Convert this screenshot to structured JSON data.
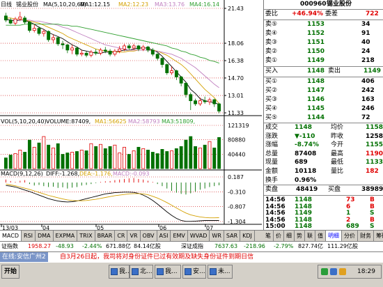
{
  "chart_header": {
    "period": "日线",
    "stock": "锡业股份",
    "ma_label": "MA(5,10,20,60)",
    "ma1": "MA1:12.15",
    "ma2": "MA2:12.23",
    "ma3": "MA3:13.76",
    "ma4": "MA4:16.14"
  },
  "price_axis": [
    "21.43",
    "18.06",
    "16.38",
    "14.70",
    "13.01",
    "11.33"
  ],
  "volume_header": {
    "label": "VOL(5,10,20,40)",
    "volume": "VOLUME:87409,",
    "ma1": "MA1:56625",
    "ma2": "MA2:58793",
    "ma3": "MA3:51809,"
  },
  "volume_axis": [
    "121319",
    "80880",
    "40440"
  ],
  "macd_header": {
    "label": "MACD(9,12,26)",
    "diff": "DIFF:-1.268,",
    "dea": "DEA:-1.176,",
    "macd": "MACD:-0.093"
  },
  "macd_axis": [
    "0.187",
    "-0.310",
    "-0.807",
    "-1.304"
  ],
  "date_labels": [
    "13/03",
    "04",
    "05",
    "06",
    "07"
  ],
  "chart_data": [
    {
      "type": "candlestick",
      "title": "日线 锡业股份",
      "ylim": [
        11.33,
        21.43
      ],
      "candles": [
        {
          "o": 20.7,
          "c": 20.3,
          "h": 21.0,
          "l": 20.1
        },
        {
          "o": 20.3,
          "c": 20.0,
          "h": 20.5,
          "l": 19.9
        },
        {
          "o": 20.0,
          "c": 20.4,
          "h": 20.6,
          "l": 19.8
        },
        {
          "o": 20.4,
          "c": 20.6,
          "h": 21.1,
          "l": 20.2
        },
        {
          "o": 20.5,
          "c": 20.1,
          "h": 20.7,
          "l": 19.9
        },
        {
          "o": 20.1,
          "c": 19.3,
          "h": 20.2,
          "l": 19.1
        },
        {
          "o": 19.3,
          "c": 19.5,
          "h": 19.9,
          "l": 19.1
        },
        {
          "o": 19.5,
          "c": 19.0,
          "h": 19.7,
          "l": 18.8
        },
        {
          "o": 19.0,
          "c": 19.2,
          "h": 19.4,
          "l": 18.7
        },
        {
          "o": 19.2,
          "c": 18.4,
          "h": 19.3,
          "l": 18.2
        },
        {
          "o": 18.4,
          "c": 18.6,
          "h": 18.9,
          "l": 18.1
        },
        {
          "o": 18.6,
          "c": 18.0,
          "h": 18.7,
          "l": 17.8
        },
        {
          "o": 18.0,
          "c": 17.9,
          "h": 18.3,
          "l": 17.5
        },
        {
          "o": 17.9,
          "c": 17.4,
          "h": 18.0,
          "l": 17.1
        },
        {
          "o": 17.4,
          "c": 17.6,
          "h": 17.9,
          "l": 17.0
        },
        {
          "o": 17.6,
          "c": 17.0,
          "h": 17.7,
          "l": 16.8
        },
        {
          "o": 17.0,
          "c": 17.1,
          "h": 17.4,
          "l": 16.8
        },
        {
          "o": 17.1,
          "c": 16.9,
          "h": 17.3,
          "l": 16.7
        },
        {
          "o": 16.9,
          "c": 17.2,
          "h": 17.4,
          "l": 16.7
        },
        {
          "o": 17.2,
          "c": 17.1,
          "h": 17.5,
          "l": 16.9
        },
        {
          "o": 17.1,
          "c": 17.4,
          "h": 17.6,
          "l": 16.9
        },
        {
          "o": 17.4,
          "c": 17.3,
          "h": 17.7,
          "l": 17.1
        },
        {
          "o": 17.3,
          "c": 17.0,
          "h": 17.5,
          "l": 16.8
        },
        {
          "o": 17.0,
          "c": 17.3,
          "h": 17.5,
          "l": 16.8
        },
        {
          "o": 17.3,
          "c": 17.5,
          "h": 17.8,
          "l": 17.1
        },
        {
          "o": 17.5,
          "c": 17.8,
          "h": 18.0,
          "l": 17.3
        },
        {
          "o": 17.8,
          "c": 17.6,
          "h": 18.0,
          "l": 17.4
        },
        {
          "o": 17.6,
          "c": 17.8,
          "h": 18.0,
          "l": 17.4
        },
        {
          "o": 17.8,
          "c": 17.5,
          "h": 17.9,
          "l": 17.3
        },
        {
          "o": 17.5,
          "c": 17.7,
          "h": 17.9,
          "l": 17.3
        },
        {
          "o": 17.7,
          "c": 17.4,
          "h": 17.8,
          "l": 17.2
        },
        {
          "o": 17.4,
          "c": 17.0,
          "h": 17.6,
          "l": 16.8
        },
        {
          "o": 17.0,
          "c": 16.6,
          "h": 17.1,
          "l": 16.4
        },
        {
          "o": 16.6,
          "c": 16.0,
          "h": 16.7,
          "l": 15.7
        },
        {
          "o": 16.0,
          "c": 15.2,
          "h": 16.1,
          "l": 15.0
        },
        {
          "o": 15.2,
          "c": 15.4,
          "h": 15.8,
          "l": 15.0
        },
        {
          "o": 15.4,
          "c": 14.8,
          "h": 15.5,
          "l": 14.5
        },
        {
          "o": 14.8,
          "c": 14.2,
          "h": 14.9,
          "l": 13.9
        },
        {
          "o": 14.2,
          "c": 13.1,
          "h": 14.3,
          "l": 12.8
        },
        {
          "o": 13.1,
          "c": 12.5,
          "h": 13.3,
          "l": 11.6
        },
        {
          "o": 12.5,
          "c": 12.2,
          "h": 12.7,
          "l": 12.0
        },
        {
          "o": 12.2,
          "c": 12.5,
          "h": 12.8,
          "l": 12.0
        },
        {
          "o": 12.5,
          "c": 12.4,
          "h": 12.9,
          "l": 12.2
        },
        {
          "o": 12.4,
          "c": 12.6,
          "h": 12.8,
          "l": 12.1
        },
        {
          "o": 12.6,
          "c": 12.2,
          "h": 12.7,
          "l": 11.9
        },
        {
          "o": 12.2,
          "c": 11.5,
          "h": 12.3,
          "l": 11.3
        }
      ],
      "series": [
        {
          "name": "MA1",
          "values": [
            20.4,
            20.3,
            20.2,
            20.3,
            20.3,
            20.1,
            19.9,
            19.6,
            19.4,
            19.1,
            18.9,
            18.7,
            18.5,
            18.2,
            17.9,
            17.7,
            17.4,
            17.3,
            17.2,
            17.1,
            17.1,
            17.2,
            17.2,
            17.2,
            17.3,
            17.4,
            17.4,
            17.5,
            17.6,
            17.6,
            17.6,
            17.4,
            17.2,
            16.8,
            16.3,
            15.8,
            15.3,
            14.8,
            14.3,
            13.6,
            13.2,
            12.7,
            12.5,
            12.4,
            12.3,
            12.15
          ]
        },
        {
          "name": "MA2",
          "values": [
            20.5,
            20.5,
            20.4,
            20.4,
            20.3,
            20.2,
            20.1,
            20.0,
            19.8,
            19.6,
            19.4,
            19.2,
            19.0,
            18.7,
            18.5,
            18.3,
            18.1,
            17.9,
            17.7,
            17.5,
            17.4,
            17.3,
            17.3,
            17.2,
            17.2,
            17.2,
            17.3,
            17.3,
            17.4,
            17.4,
            17.4,
            17.4,
            17.3,
            17.1,
            16.9,
            16.6,
            16.3,
            16.0,
            15.6,
            15.1,
            14.6,
            14.1,
            13.6,
            13.2,
            12.8,
            12.23
          ]
        },
        {
          "name": "MA3",
          "values": [
            20.3,
            20.3,
            20.3,
            20.3,
            20.3,
            20.3,
            20.2,
            20.2,
            20.1,
            20.0,
            19.9,
            19.8,
            19.6,
            19.5,
            19.3,
            19.1,
            18.9,
            18.7,
            18.5,
            18.3,
            18.1,
            17.9,
            17.8,
            17.7,
            17.6,
            17.5,
            17.4,
            17.4,
            17.4,
            17.4,
            17.4,
            17.3,
            17.3,
            17.2,
            17.1,
            17.0,
            16.8,
            16.6,
            16.3,
            16.0,
            15.7,
            15.3,
            14.9,
            14.5,
            14.1,
            13.76
          ]
        },
        {
          "name": "MA4",
          "values": [
            19.8,
            19.8,
            19.8,
            19.8,
            19.9,
            19.9,
            19.9,
            19.9,
            19.9,
            19.9,
            19.9,
            19.9,
            19.8,
            19.8,
            19.7,
            19.7,
            19.6,
            19.5,
            19.4,
            19.3,
            19.2,
            19.1,
            19.0,
            18.9,
            18.8,
            18.7,
            18.6,
            18.5,
            18.4,
            18.3,
            18.2,
            18.1,
            18.0,
            17.9,
            17.8,
            17.6,
            17.5,
            17.3,
            17.2,
            17.0,
            16.9,
            16.7,
            16.6,
            16.4,
            16.3,
            16.14
          ]
        }
      ]
    },
    {
      "type": "bar",
      "title": "VOL(5,10,20,40)",
      "ylim": [
        0,
        121319
      ],
      "values": [
        30000,
        38000,
        42000,
        52000,
        46000,
        80000,
        60000,
        72000,
        90000,
        66000,
        58000,
        70000,
        40000,
        44000,
        46000,
        48000,
        52000,
        50000,
        70000,
        62000,
        68000,
        56000,
        62000,
        66000,
        44000,
        60000,
        40000,
        50000,
        60000,
        56000,
        52000,
        46000,
        42000,
        54000,
        48000,
        50000,
        56000,
        62000,
        80000,
        90000,
        62000,
        58000,
        66000,
        76000,
        58000,
        87409
      ]
    },
    {
      "type": "bar",
      "title": "MACD(9,12,26)",
      "ylim": [
        -1.304,
        0.187
      ],
      "values": [
        0.1,
        0.05,
        0.02,
        0.06,
        0.08,
        -0.05,
        -0.1,
        -0.08,
        -0.12,
        -0.15,
        -0.14,
        -0.18,
        -0.16,
        -0.2,
        -0.17,
        -0.15,
        -0.1,
        -0.08,
        -0.05,
        -0.02,
        0.02,
        0.04,
        0.05,
        0.08,
        0.1,
        0.12,
        0.14,
        0.15,
        0.12,
        0.1,
        0.06,
        0.02,
        -0.05,
        -0.12,
        -0.2,
        -0.28,
        -0.34,
        -0.38,
        -0.4,
        -0.36,
        -0.3,
        -0.24,
        -0.2,
        -0.15,
        -0.12,
        -0.093
      ],
      "series": [
        {
          "name": "DIFF",
          "values": [
            -0.1,
            -0.12,
            -0.15,
            -0.2,
            -0.25,
            -0.3,
            -0.36,
            -0.42,
            -0.48,
            -0.54,
            -0.58,
            -0.62,
            -0.64,
            -0.65,
            -0.64,
            -0.62,
            -0.58,
            -0.54,
            -0.5,
            -0.46,
            -0.42,
            -0.38,
            -0.36,
            -0.34,
            -0.33,
            -0.32,
            -0.32,
            -0.33,
            -0.36,
            -0.42,
            -0.5,
            -0.6,
            -0.72,
            -0.85,
            -0.98,
            -1.1,
            -1.2,
            -1.27,
            -1.3,
            -1.3,
            -1.29,
            -1.28,
            -1.27,
            -1.27,
            -1.27,
            -1.268
          ]
        },
        {
          "name": "DEA",
          "values": [
            -0.05,
            -0.08,
            -0.11,
            -0.15,
            -0.19,
            -0.23,
            -0.28,
            -0.33,
            -0.38,
            -0.43,
            -0.47,
            -0.51,
            -0.55,
            -0.58,
            -0.6,
            -0.61,
            -0.61,
            -0.6,
            -0.58,
            -0.56,
            -0.53,
            -0.5,
            -0.47,
            -0.44,
            -0.42,
            -0.4,
            -0.38,
            -0.37,
            -0.37,
            -0.38,
            -0.41,
            -0.46,
            -0.52,
            -0.59,
            -0.67,
            -0.76,
            -0.85,
            -0.94,
            -1.02,
            -1.08,
            -1.12,
            -1.15,
            -1.17,
            -1.18,
            -1.18,
            -1.176
          ]
        }
      ]
    }
  ],
  "quote": {
    "code": "000960",
    "name": "锡业股份",
    "ratio_label": "委比",
    "ratio_value": "+46.94%",
    "diff_label": "委差",
    "diff_value": "722",
    "sell": [
      {
        "label": "卖⑤",
        "price": "1153",
        "vol": "34"
      },
      {
        "label": "卖④",
        "price": "1152",
        "vol": "91"
      },
      {
        "label": "卖③",
        "price": "1151",
        "vol": "40"
      },
      {
        "label": "卖②",
        "price": "1150",
        "vol": "24"
      },
      {
        "label": "卖①",
        "price": "1149",
        "vol": "218"
      }
    ],
    "buyin_label": "买入",
    "buyin_value": "1148",
    "sellout_label": "卖出",
    "sellout_value": "1149",
    "buy": [
      {
        "label": "买①",
        "price": "1148",
        "vol": "406"
      },
      {
        "label": "买②",
        "price": "1147",
        "vol": "242"
      },
      {
        "label": "买③",
        "price": "1146",
        "vol": "163"
      },
      {
        "label": "买④",
        "price": "1145",
        "vol": "246"
      },
      {
        "label": "买⑤",
        "price": "1144",
        "vol": "72"
      }
    ],
    "stats": [
      {
        "l1": "成交",
        "v1": "1148",
        "l2": "均价",
        "v2": "1158"
      },
      {
        "l1": "涨跌",
        "v1": "▼-110",
        "l2": "昨收",
        "v2": "1258"
      },
      {
        "l1": "涨幅",
        "v1": "-8.74%",
        "l2": "今开",
        "v2": "1155"
      },
      {
        "l1": "总量",
        "v1": "87408",
        "l2": "最高",
        "v2": "1190"
      },
      {
        "l1": "现量",
        "v1": "689",
        "l2": "最低",
        "v2": "1133"
      },
      {
        "l1": "金额",
        "v1": "10118",
        "l2": "量比",
        "v2": "182"
      },
      {
        "l1": "换手",
        "v1": "0.96%",
        "l2": "",
        "v2": ""
      }
    ],
    "outer_label": "卖盘",
    "outer_value": "48419",
    "inner_label": "买盘",
    "inner_value": "38989",
    "ticks": [
      {
        "time": "14:56",
        "price": "1148",
        "vol": "73",
        "side": "B"
      },
      {
        "time": "14:56",
        "price": "1148",
        "vol": "6",
        "side": "B"
      },
      {
        "time": "14:56",
        "price": "1149",
        "vol": "1",
        "side": "S"
      },
      {
        "time": "14:56",
        "price": "1148",
        "vol": "2",
        "side": "B"
      },
      {
        "time": "15:00",
        "price": "1148",
        "vol": "689",
        "side": "S"
      }
    ]
  },
  "bottom_tabs": [
    "MACD",
    "RSI",
    "DMA",
    "EXPMA",
    "TRIX",
    "BRAR",
    "CR",
    "VR",
    "OBV",
    "ASI",
    "EMV",
    "WVAD",
    "WR",
    "SAR",
    "KDJ"
  ],
  "side_tabs": [
    "笔",
    "价",
    "细",
    "势",
    "联",
    "值",
    "明细",
    "分价",
    "财务",
    "筹码分布"
  ],
  "index_bar": {
    "name1": "证指数",
    "val1": "1958.27",
    "chg1": "-48.93",
    "pct1": "-2.44%",
    "amt1": "671.88亿",
    "amt1b": "84.14亿股",
    "name2": "深证成指",
    "val2": "7637.63",
    "chg2": "-218.96",
    "pct2": "-2.79%",
    "amt2": "827.74亿",
    "amt2b": "111.29亿股"
  },
  "news": {
    "label": "在线:安信广州2",
    "text": "自3月26日起，我司将对身份证件已过有效期及缺失身份证件到期日信"
  },
  "taskbar": {
    "start": "开始",
    "buttons": [
      "我...",
      "北...",
      "我...",
      "安...",
      "未..."
    ],
    "clock": "18:29"
  },
  "colors": {
    "up": "#e00000",
    "down": "#007000",
    "ma1": "#000000",
    "ma2": "#d4a000",
    "ma3": "#c080c0",
    "ma4": "#30a030",
    "diff": "#000000",
    "dea": "#d4a000"
  }
}
